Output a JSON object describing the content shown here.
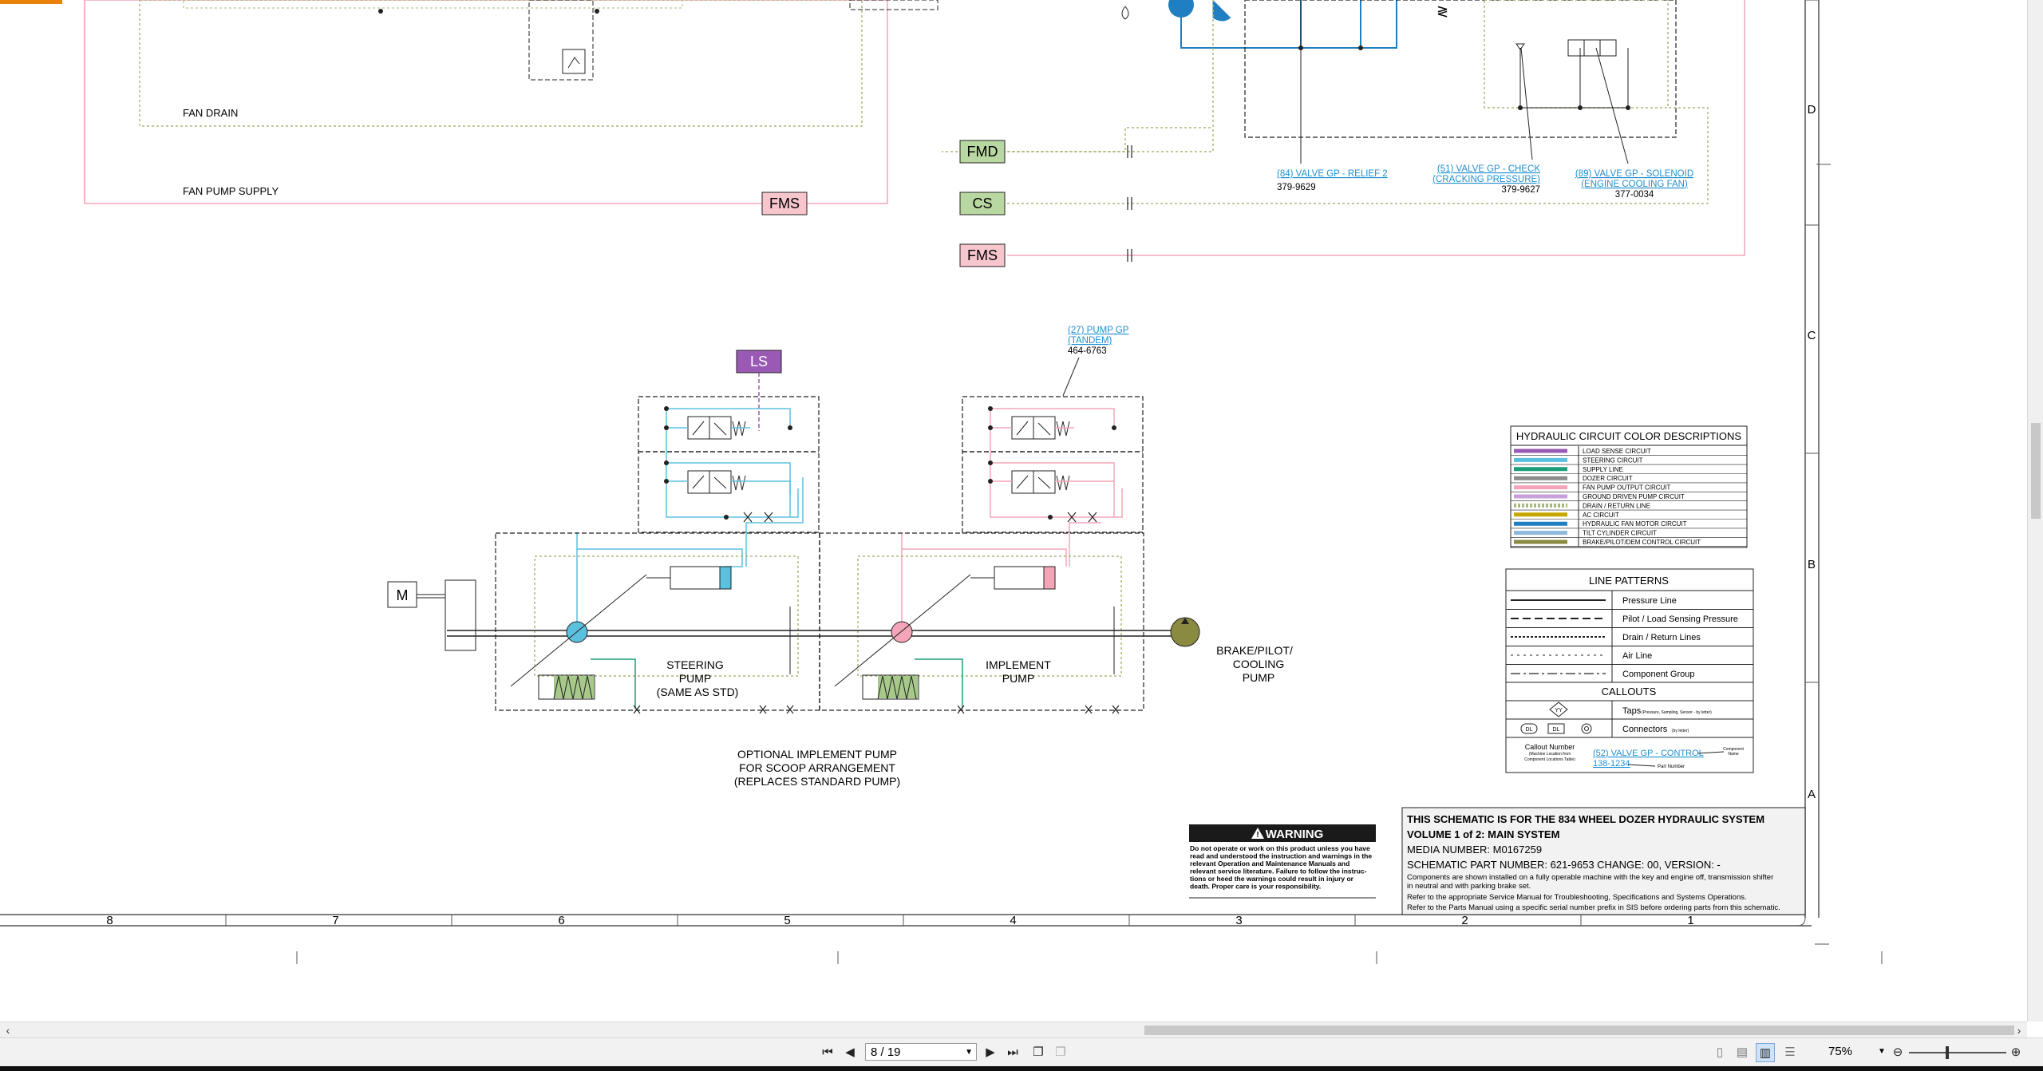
{
  "schematic": {
    "labels": {
      "fan_drain": "FAN  DRAIN",
      "fan_pump_supply": "FAN  PUMP  SUPPLY",
      "steering_pump": [
        "STEERING",
        "PUMP",
        "(SAME  AS  STD)"
      ],
      "implement_pump": [
        "IMPLEMENT",
        "PUMP"
      ],
      "brake_pump": [
        "BRAKE/PILOT/",
        "COOLING",
        "PUMP"
      ],
      "optional_note": [
        "OPTIONAL IMPLEMENT PUMP",
        "FOR SCOOP ARRANGEMENT",
        "(REPLACES STANDARD PUMP)"
      ],
      "motor": "M"
    },
    "connectors": [
      {
        "id": "FMS",
        "color": "#f6c6cc"
      },
      {
        "id": "FMD",
        "color": "#b9d7a0"
      },
      {
        "id": "CS",
        "color": "#b9d7a0"
      },
      {
        "id": "FMS",
        "color": "#f6c6cc"
      },
      {
        "id": "LS",
        "color": "#9b59b6"
      }
    ],
    "callouts": [
      {
        "name": [
          "(84) VALVE GP - RELIEF 2"
        ],
        "part": "379-9629"
      },
      {
        "name": [
          "(51) VALVE GP - CHECK",
          "(CRACKING PRESSURE)"
        ],
        "part": "379-9627"
      },
      {
        "name": [
          "(89) VALVE GP - SOLENOID",
          "(ENGINE COOLING FAN)"
        ],
        "part": "377-0034"
      },
      {
        "name": [
          "(27) PUMP GP",
          "(TANDEM)"
        ],
        "part": "464-6763"
      }
    ],
    "grid": {
      "columns": [
        "8",
        "7",
        "6",
        "5",
        "4",
        "3",
        "2",
        "1"
      ],
      "rows": [
        "D",
        "C",
        "B",
        "A"
      ]
    }
  },
  "legend": {
    "title": "HYDRAULIC CIRCUIT COLOR DESCRIPTIONS",
    "items": [
      {
        "label": "LOAD SENSE CIRCUIT",
        "color": "#9b59b6"
      },
      {
        "label": "STEERING CIRCUIT",
        "color": "#5bc0de"
      },
      {
        "label": "SUPPLY LINE",
        "color": "#1a9e7a"
      },
      {
        "label": "DOZER CIRCUIT",
        "color": "#8c8c8c"
      },
      {
        "label": "FAN PUMP OUTPUT CIRCUIT",
        "color": "#f4a6b8"
      },
      {
        "label": "GROUND DRIVEN PUMP CIRCUIT",
        "color": "#c9a0dc"
      },
      {
        "label": "DRAIN / RETURN LINE",
        "color": "#a8b878"
      },
      {
        "label": "AC CIRCUIT",
        "color": "#c8a800"
      },
      {
        "label": "HYDRAULIC FAN MOTOR CIRCUIT",
        "color": "#1f7fc0"
      },
      {
        "label": "TILT CYLINDER CIRCUIT",
        "color": "#8fb8de"
      },
      {
        "label": "BRAKE/PILOT/DEM CONTROL CIRCUIT",
        "color": "#8a8a40"
      }
    ]
  },
  "patterns": {
    "title": "LINE PATTERNS",
    "items": [
      "Pressure Line",
      "Pilot / Load Sensing Pressure",
      "Drain / Return Lines",
      "Air Line",
      "Component Group"
    ],
    "callouts_title": "CALLOUTS",
    "taps": "Taps",
    "taps_note": "(Pressure, Sampling, Sensor - by letter)",
    "taps_symbol": "YY",
    "connectors": "Connectors",
    "connectors_note": "(by letter)",
    "connector_symbols": [
      "DL",
      "DL"
    ],
    "example_label": "Callout Number",
    "example_sub": [
      "(Machine Location from",
      "Component Locations Table)"
    ],
    "example_callout": "(52) VALVE GP - CONTROL",
    "example_part": "138-1234",
    "component_name": [
      "Component",
      "Name"
    ],
    "part_number": "Part Number"
  },
  "warning": {
    "title": "WARNING",
    "text": [
      "Do not operate or work on this product unless you have",
      "read and understood the instruction and warnings in the",
      "relevant Operation and Maintenance Manuals and",
      "relevant service literature. Failure to follow the instruc-",
      "tions or heed the warnings could result in injury or",
      "death. Proper care is your responsibility."
    ]
  },
  "titleblock": {
    "line1": "THIS SCHEMATIC IS FOR THE 834 WHEEL DOZER HYDRAULIC SYSTEM",
    "line2": "VOLUME 1 of 2: MAIN SYSTEM",
    "media": "MEDIA NUMBER: M0167259",
    "part": "SCHEMATIC PART NUMBER: 621-9653 CHANGE: 00, VERSION: -",
    "note1": "Components are shown installed on a fully operable machine with the key and engine off, transmission shifter",
    "note1b": "in neutral and with parking brake set.",
    "note2": "Refer to the appropriate Service Manual for Troubleshooting, Specifications and Systems Operations.",
    "note3": "Refer to the Parts Manual using a specific serial number prefix in SIS before ordering parts from this schematic."
  },
  "viewer": {
    "page_value": "8 / 19",
    "zoom_value": "75%",
    "icons": [
      "first-page-icon",
      "prev-page-icon",
      "next-page-icon",
      "last-page-icon",
      "two-page-icon",
      "copy-icon",
      "single-page-view-icon",
      "continuous-view-icon",
      "facing-view-icon",
      "facing-continuous-view-icon",
      "zoom-out-icon",
      "zoom-in-icon"
    ]
  }
}
